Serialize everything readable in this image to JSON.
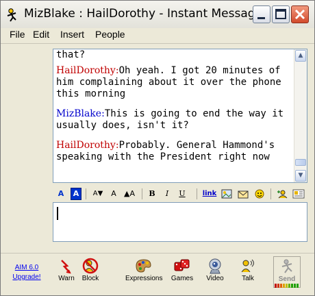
{
  "window": {
    "title": "MizBlake : HailDorothy - Instant Message"
  },
  "menu": {
    "items": [
      "File",
      "Edit",
      "Insert",
      "People"
    ]
  },
  "conversation": {
    "partial_top": "that?",
    "messages": [
      {
        "sender": "HailDorothy:",
        "text": "Oh yeah. I got 20 minutes of him complaining about it over the phone this morning",
        "color": "#c00000"
      },
      {
        "sender": "MizBlake:",
        "text": "This is going to end the way it usually does, isn't it?",
        "color": "#0000cc"
      },
      {
        "sender": "HailDorothy:",
        "text": "Probably. General Hammond's speaking with the President right now",
        "color": "#c00000"
      }
    ]
  },
  "format_toolbar": {
    "items": [
      "A",
      "A",
      "A▼",
      "A",
      "▲A",
      "B",
      "I",
      "U",
      "link",
      "image-icon",
      "email-icon",
      "smiley-icon",
      "buddy-icon",
      "info-icon"
    ]
  },
  "input": {
    "value": ""
  },
  "bottom": {
    "upgrade_line1": "AIM 6.0",
    "upgrade_line2": "Upgrade!",
    "tools": [
      {
        "label": "Warn",
        "icon": "warn-icon"
      },
      {
        "label": "Block",
        "icon": "block-icon"
      },
      {
        "label": "Expressions",
        "icon": "palette-icon"
      },
      {
        "label": "Games",
        "icon": "dice-icon"
      },
      {
        "label": "Video",
        "icon": "webcam-icon"
      },
      {
        "label": "Talk",
        "icon": "talk-icon"
      }
    ],
    "send_label": "Send"
  }
}
